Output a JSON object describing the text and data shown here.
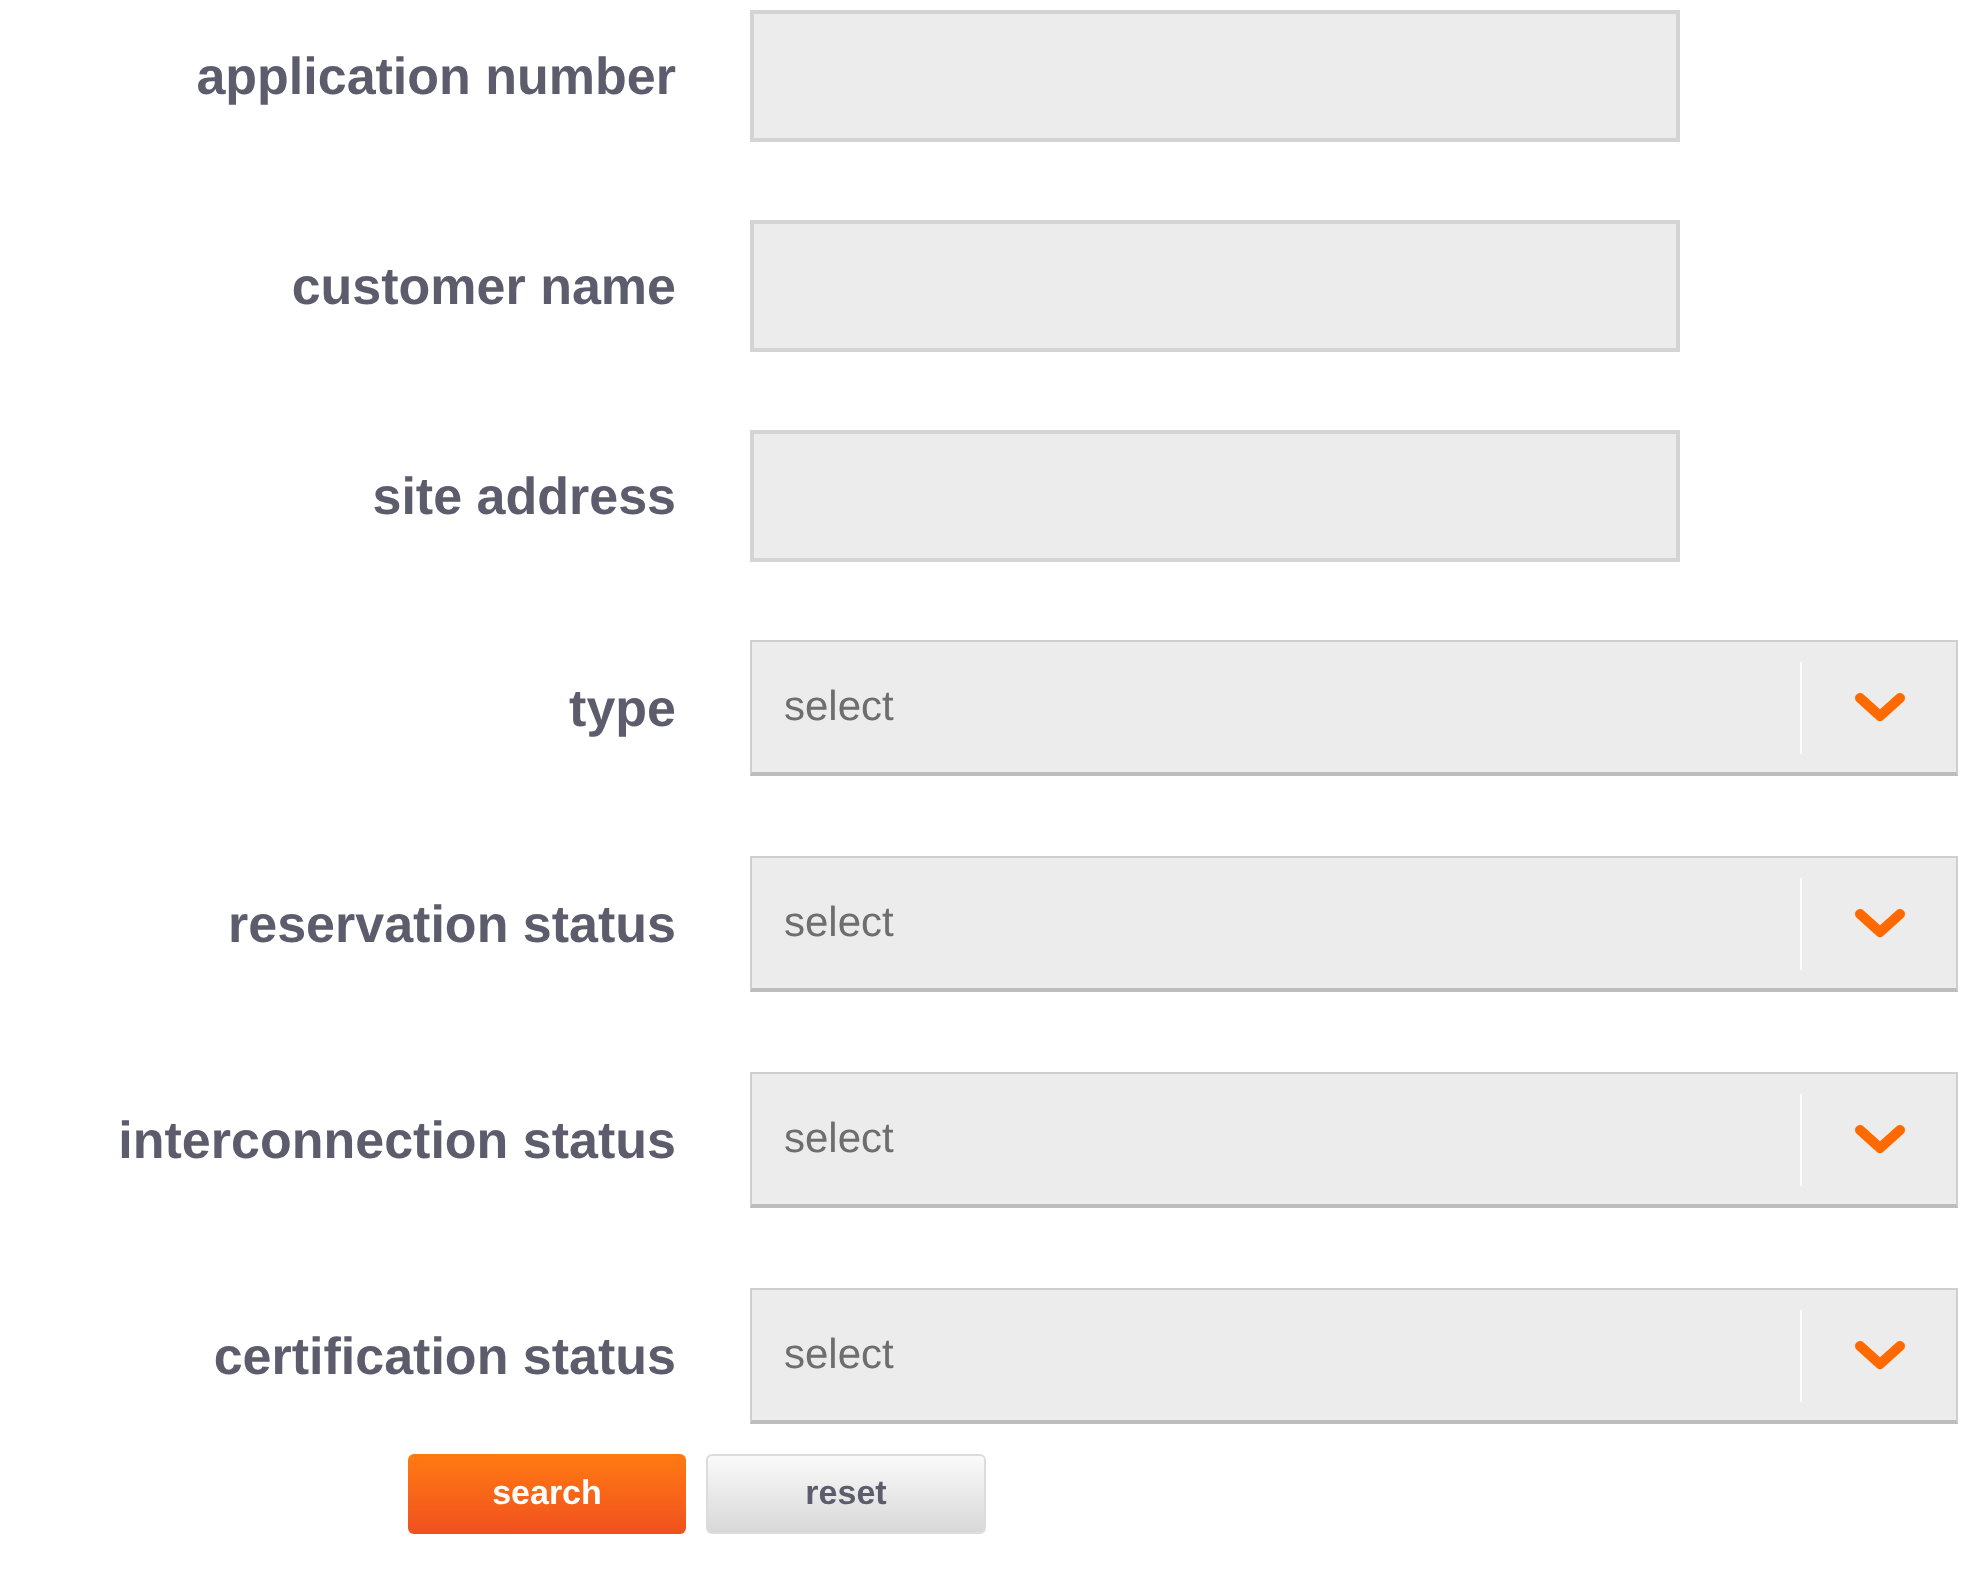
{
  "fields": [
    {
      "kind": "text",
      "label": "application number"
    },
    {
      "kind": "text",
      "label": "customer name"
    },
    {
      "kind": "text",
      "label": "site address"
    },
    {
      "kind": "select",
      "label": "type",
      "value": "select"
    },
    {
      "kind": "select",
      "label": "reservation status",
      "value": "select"
    },
    {
      "kind": "select",
      "label": "interconnection status",
      "value": "select"
    },
    {
      "kind": "select",
      "label": "certification status",
      "value": "select"
    }
  ],
  "buttons": [
    {
      "kind": "primary",
      "label": "search"
    },
    {
      "kind": "secondary",
      "label": "reset"
    }
  ]
}
